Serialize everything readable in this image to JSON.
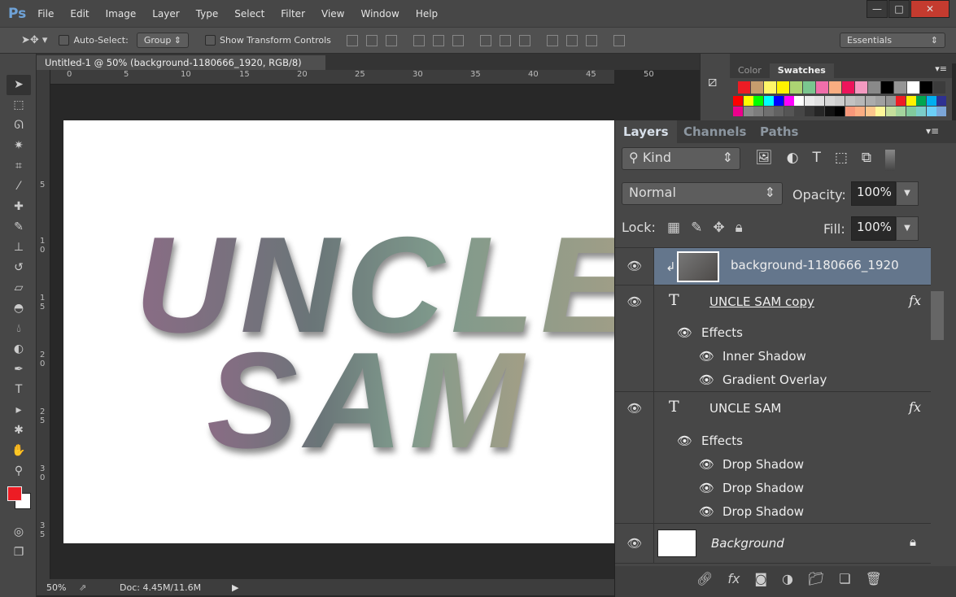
{
  "app": {
    "logo": "Ps",
    "menu": [
      "File",
      "Edit",
      "Image",
      "Layer",
      "Type",
      "Select",
      "Filter",
      "View",
      "Window",
      "Help"
    ],
    "window_controls": [
      "minimize",
      "maximize",
      "close"
    ]
  },
  "options": {
    "auto_select_label": "Auto-Select:",
    "auto_select_value": "Group",
    "show_transform_label": "Show Transform Controls",
    "workspace": "Essentials"
  },
  "document": {
    "tab_title": "Untitled-1 @ 50% (background-1180666_1920, RGB/8) *",
    "close": "×",
    "canvas_text_line1": "UNCLE",
    "canvas_text_line2": "SAM"
  },
  "rulers": {
    "h": [
      "0",
      "5",
      "10",
      "15",
      "20",
      "25",
      "30",
      "35",
      "40",
      "45",
      "50"
    ],
    "v": [
      "5",
      "1 0",
      "1 5",
      "2 0",
      "2 5",
      "3 0",
      "3 5"
    ]
  },
  "status": {
    "zoom": "50%",
    "doc": "Doc: 4.45M/11.6M"
  },
  "swatches_panel": {
    "tabs": [
      "Color",
      "Swatches"
    ],
    "active": "Swatches",
    "recent": [
      "#ed1c24",
      "#c69c6d",
      "#fff568",
      "#fff200",
      "#acd373",
      "#7ac68f",
      "#f06eaa",
      "#f9ad81",
      "#ed145b",
      "#f49ac1",
      "#898989",
      "#000000",
      "#959595",
      "#ffffff",
      "#000000",
      "#3c3c3c"
    ],
    "row1": [
      "#ff0000",
      "#ffff00",
      "#00ff00",
      "#00ffff",
      "#0000ff",
      "#ff00ff",
      "#ffffff",
      "#ebebeb",
      "#e1e1e1",
      "#d7d7d7",
      "#cccccc",
      "#c2c2c2",
      "#b7b7b7",
      "#acacac",
      "#a0a0a0",
      "#959595",
      "#ee1d24",
      "#fff100",
      "#00a650",
      "#00aeef",
      "#2f3192"
    ],
    "row2": [
      "#ec008c",
      "#898989",
      "#7d7d7d",
      "#707070",
      "#626262",
      "#555555",
      "#464646",
      "#363636",
      "#262626",
      "#111111",
      "#000000",
      "#f7977a",
      "#fbad82",
      "#fdc68c",
      "#fff799",
      "#c6df9c",
      "#a4d49d",
      "#81ca9d",
      "#7bcdc9",
      "#6ccff7",
      "#7ca6d8"
    ]
  },
  "layers_panel": {
    "tabs": [
      "Layers",
      "Channels",
      "Paths"
    ],
    "active": "Layers",
    "filter": "Kind",
    "blend_mode": "Normal",
    "opacity_label": "Opacity:",
    "opacity": "100%",
    "lock_label": "Lock:",
    "fill_label": "Fill:",
    "fill": "100%",
    "layers": [
      {
        "name": "background-1180666_1920",
        "type": "smart",
        "selected": true
      },
      {
        "name": "UNCLE SAM copy",
        "type": "text",
        "fx": "fx",
        "effects_label": "Effects",
        "effects": [
          "Inner Shadow",
          "Gradient Overlay"
        ]
      },
      {
        "name": "UNCLE SAM",
        "type": "text",
        "fx": "fx",
        "effects_label": "Effects",
        "effects": [
          "Drop Shadow",
          "Drop Shadow",
          "Drop Shadow"
        ]
      },
      {
        "name": "Background",
        "type": "pixel",
        "locked": true
      }
    ]
  },
  "colors": {
    "foreground": "#ed1c24",
    "background": "#ffffff",
    "selected_layer": "#64768c"
  }
}
